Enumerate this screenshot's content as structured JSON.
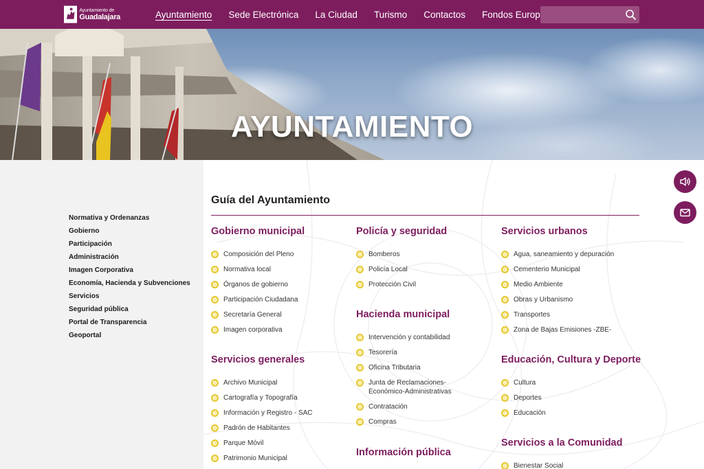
{
  "header": {
    "logo": {
      "small": "Ayuntamiento de",
      "big": "Guadalajara"
    },
    "nav": [
      {
        "label": "Ayuntamiento",
        "active": true
      },
      {
        "label": "Sede Electrónica"
      },
      {
        "label": "La Ciudad"
      },
      {
        "label": "Turismo"
      },
      {
        "label": "Contactos"
      },
      {
        "label": "Fondos Europeos"
      }
    ],
    "search": {
      "placeholder": "",
      "icon": "search-icon"
    }
  },
  "hero": {
    "title": "AYUNTAMIENTO"
  },
  "sidebar": {
    "items": [
      "Normativa y Ordenanzas",
      "Gobierno",
      "Participación",
      "Administración",
      "Imagen Corporativa",
      "Economía, Hacienda y Subvenciones",
      "Servicios",
      "Seguridad pública",
      "Portal de Transparencia",
      "Geoportal"
    ]
  },
  "main": {
    "title": "Guía del Ayuntamiento",
    "sections": {
      "gobierno": {
        "title": "Gobierno municipal",
        "links": [
          "Composición del Pleno",
          "Normativa local",
          "Órganos de gobierno",
          "Participación Ciudadana",
          "Secretaría General",
          "Imagen corporativa"
        ]
      },
      "servicios_generales": {
        "title": "Servicios generales",
        "links": [
          "Archivo Municipal",
          "Cartografía y Topografía",
          "Información y Registro - SAC",
          "Padrón de Habitantes",
          "Parque Móvil",
          "Patrimonio Municipal"
        ]
      },
      "policia": {
        "title": "Policía y seguridad",
        "links": [
          "Bomberos",
          "Policía Local",
          "Protección Civil"
        ]
      },
      "hacienda": {
        "title": "Hacienda municipal",
        "links": [
          "Intervención y contabilidad",
          "Tesorería",
          "Oficina Tributaria",
          "Junta de Reclamaciones-Económico-Administrativas",
          "Contratación",
          "Compras"
        ]
      },
      "informacion": {
        "title": "Información pública",
        "links": []
      },
      "urbanos": {
        "title": "Servicios urbanos",
        "links": [
          "Agua, saneamiento y depuración",
          "Cementerio Municipal",
          "Medio Ambiente",
          "Obras y Urbanismo",
          "Transportes",
          "Zona de Bajas Emisiones -ZBE-"
        ]
      },
      "educacion": {
        "title": "Educación, Cultura y Deporte",
        "links": [
          "Cultura",
          "Deportes",
          "Educación"
        ]
      },
      "comunidad": {
        "title": "Servicios a la Comunidad",
        "links": [
          "Bienestar Social"
        ]
      }
    }
  },
  "floating": [
    {
      "icon": "speaker-icon"
    },
    {
      "icon": "mail-icon"
    }
  ],
  "colors": {
    "brand": "#7d1d5e",
    "bullet": "#e5c830",
    "sidebar_bg": "#f2f2f2"
  }
}
